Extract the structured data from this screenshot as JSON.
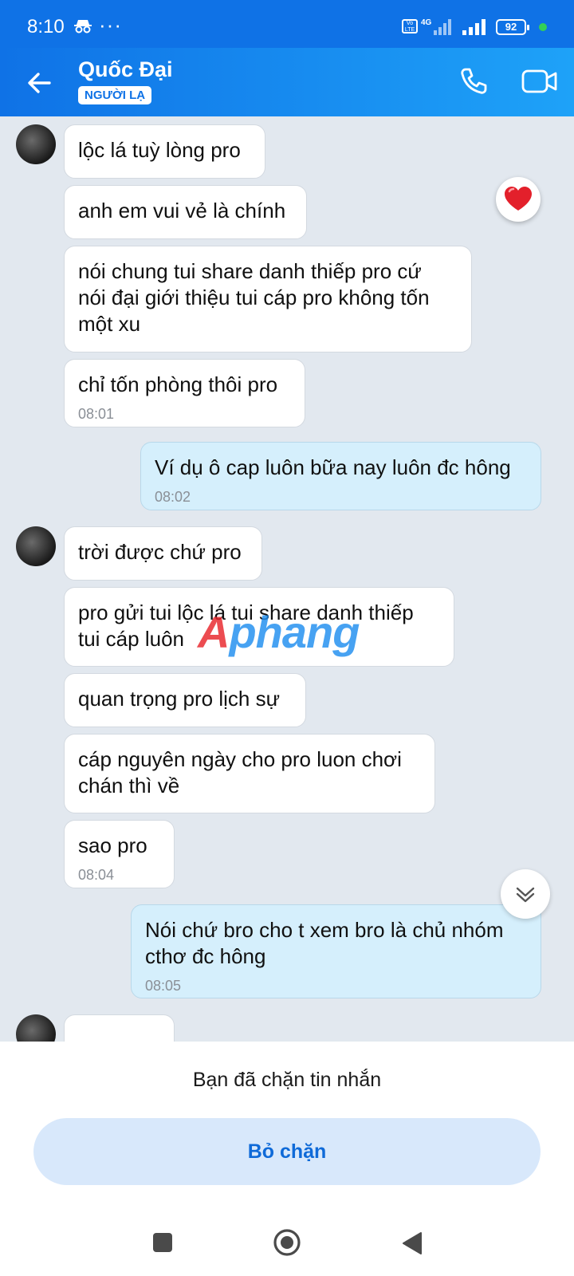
{
  "status_bar": {
    "time": "8:10",
    "volte_label": "Vo LTE",
    "network": "4G",
    "battery": "92",
    "icons": [
      "incognito-icon",
      "more-dots-icon",
      "signal-icon",
      "battery-icon"
    ]
  },
  "header": {
    "name": "Quốc Đại",
    "badge": "NGƯỜI LẠ",
    "icons": [
      "back-arrow-icon",
      "phone-icon",
      "video-call-icon"
    ]
  },
  "messages": [
    {
      "dir": "in",
      "text": "lộc lá tuỳ lòng pro",
      "time": ""
    },
    {
      "dir": "in",
      "text": "anh em vui vẻ là chính",
      "time": ""
    },
    {
      "dir": "in",
      "text": "nói chung tui share danh thiếp pro cứ\nnói đại giới thiệu tui cáp pro không tốn\nmột xu",
      "time": ""
    },
    {
      "dir": "in",
      "text": "chỉ tốn phòng thôi pro",
      "time": "08:01"
    },
    {
      "dir": "out",
      "text": "Ví dụ ô cap luôn bữa nay luôn đc hông",
      "time": "08:02"
    },
    {
      "dir": "in",
      "text": "trời được chứ pro",
      "time": ""
    },
    {
      "dir": "in",
      "text": "pro gửi tui lộc lá tui share danh thiếp\ntui cáp luôn",
      "time": ""
    },
    {
      "dir": "in",
      "text": "quan trọng pro lịch sự",
      "time": ""
    },
    {
      "dir": "in",
      "text": "cáp nguyên ngày cho pro luon chơi\nchán thì về",
      "time": ""
    },
    {
      "dir": "in",
      "text": "sao pro",
      "time": "08:04"
    },
    {
      "dir": "out",
      "text": "Nói chứ bro cho t xem bro là chủ nhóm\ncthơ đc hông",
      "time": "08:05"
    }
  ],
  "reaction": "heart-icon",
  "watermark": {
    "a": "A",
    "rest": "phang"
  },
  "footer": {
    "blocked_text": "Bạn đã chặn tin nhắn",
    "unblock_label": "Bỏ chặn"
  },
  "colors": {
    "accent": "#0f72e6",
    "outgoing_bubble": "#d5effc",
    "chat_bg": "#e2e8ef"
  }
}
